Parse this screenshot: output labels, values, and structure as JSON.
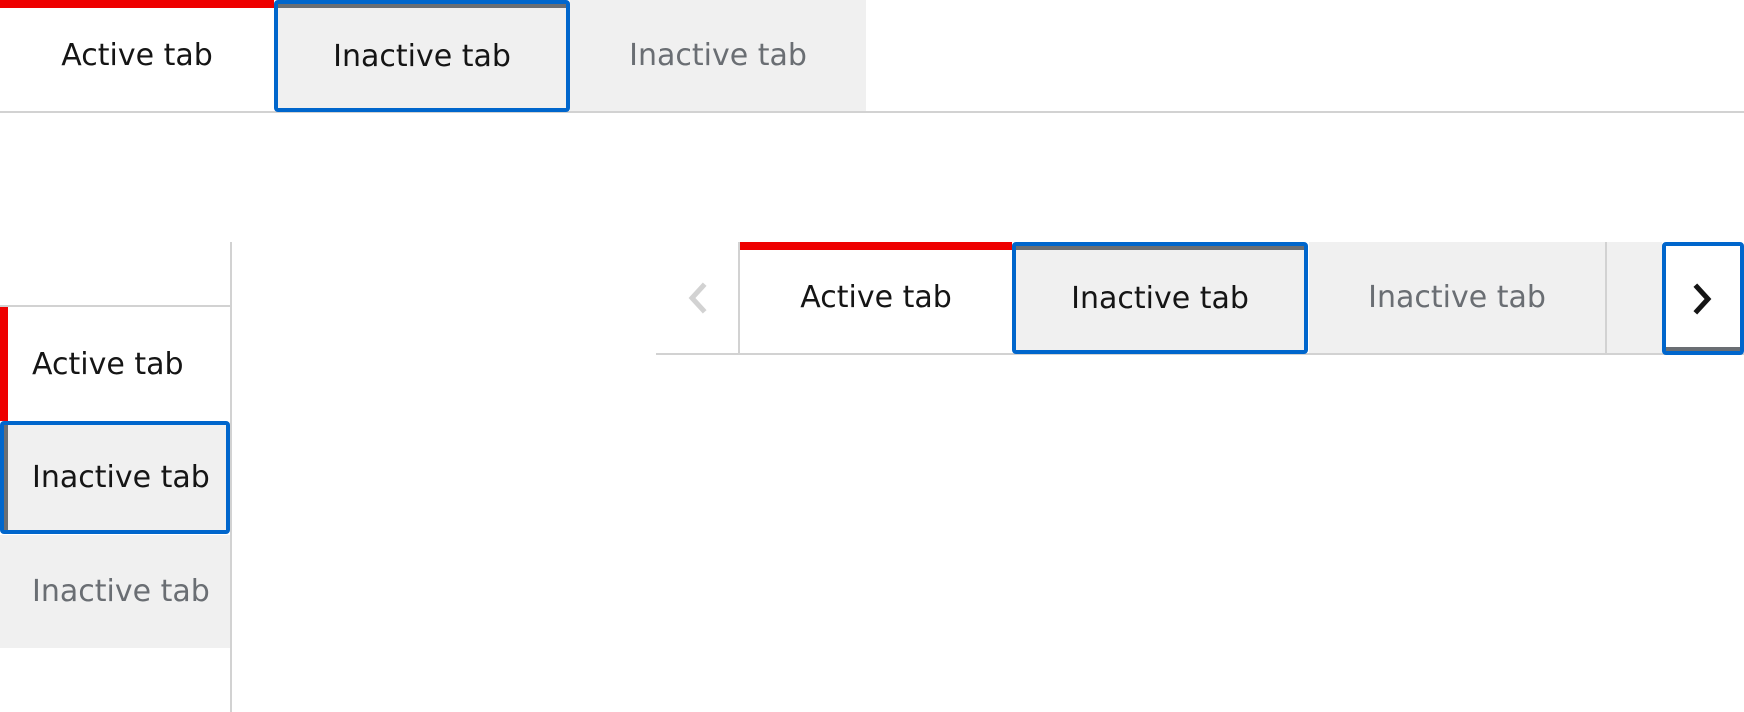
{
  "horizontal_tabs": {
    "tabs": [
      {
        "label": "Active tab",
        "state": "active"
      },
      {
        "label": "Inactive tab",
        "state": "focused"
      },
      {
        "label": "Inactive tab",
        "state": "inactive"
      }
    ]
  },
  "vertical_tabs": {
    "tabs": [
      {
        "label": "Active tab",
        "state": "active"
      },
      {
        "label": "Inactive tab",
        "state": "focused"
      },
      {
        "label": "Inactive tab",
        "state": "inactive"
      }
    ]
  },
  "scrollable_tabs": {
    "scroll_left": {
      "icon": "chevron-left-icon",
      "disabled": true
    },
    "scroll_right": {
      "icon": "chevron-right-icon",
      "disabled": false,
      "focused": true
    },
    "tabs": [
      {
        "label": "Active tab",
        "state": "active"
      },
      {
        "label": "Inactive tab",
        "state": "focused"
      },
      {
        "label": "Inactive tab",
        "state": "inactive"
      },
      {
        "label": "",
        "state": "inactive-partial"
      }
    ]
  },
  "colors": {
    "active_indicator": "#ee0000",
    "focus_outline": "#0066cc",
    "inactive_bg": "#f0f0f0",
    "border": "#d2d2d2",
    "hover_indicator": "#6a6e73"
  }
}
